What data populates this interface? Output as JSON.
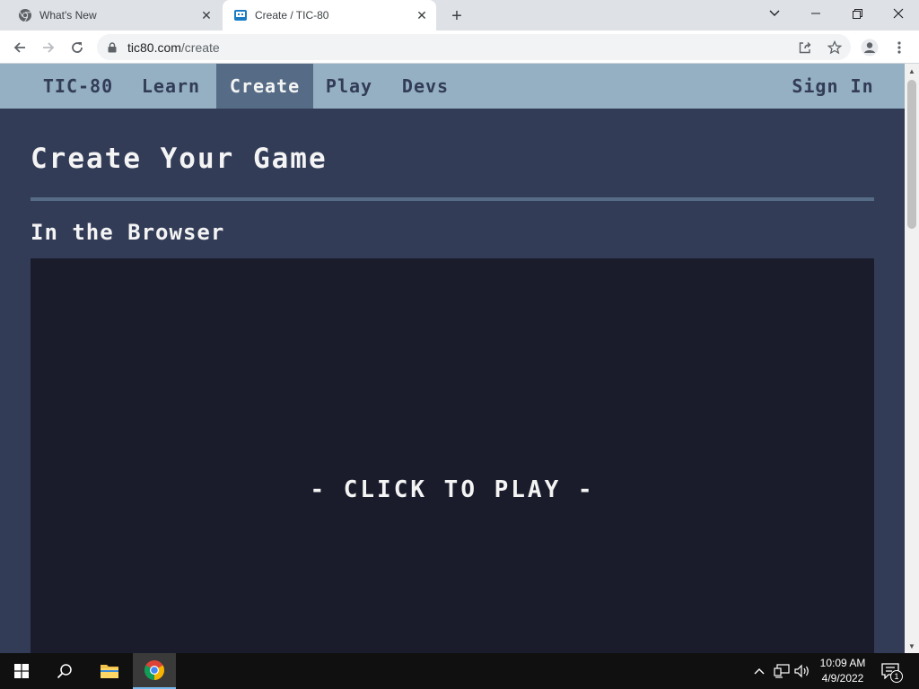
{
  "browser": {
    "tabs": [
      {
        "title": "What's New",
        "icon": "chrome-icon",
        "active": false
      },
      {
        "title": "Create / TIC-80",
        "icon": "tic80-icon",
        "active": true
      }
    ],
    "address": {
      "host": "tic80.com",
      "path": "/create"
    }
  },
  "site": {
    "nav": {
      "brand": "TIC-80",
      "items": [
        "Learn",
        "Create",
        "Play",
        "Devs"
      ],
      "active": "Create",
      "sign_in": "Sign In"
    },
    "heading": "Create Your Game",
    "section_title": "In the Browser",
    "player": {
      "prompt": "- CLICK TO PLAY -"
    }
  },
  "taskbar": {
    "apps": [
      "windows-start-icon",
      "search-icon",
      "file-explorer-icon",
      "chrome-icon"
    ],
    "clock": {
      "time": "10:09 AM",
      "date": "4/9/2022"
    },
    "notification_count": "1"
  },
  "colors": {
    "page_bg": "#333c57",
    "nav_bg": "#94b0c2",
    "nav_active": "#566c86",
    "game_bg": "#1a1c2c",
    "text_light": "#f4f4f4"
  }
}
